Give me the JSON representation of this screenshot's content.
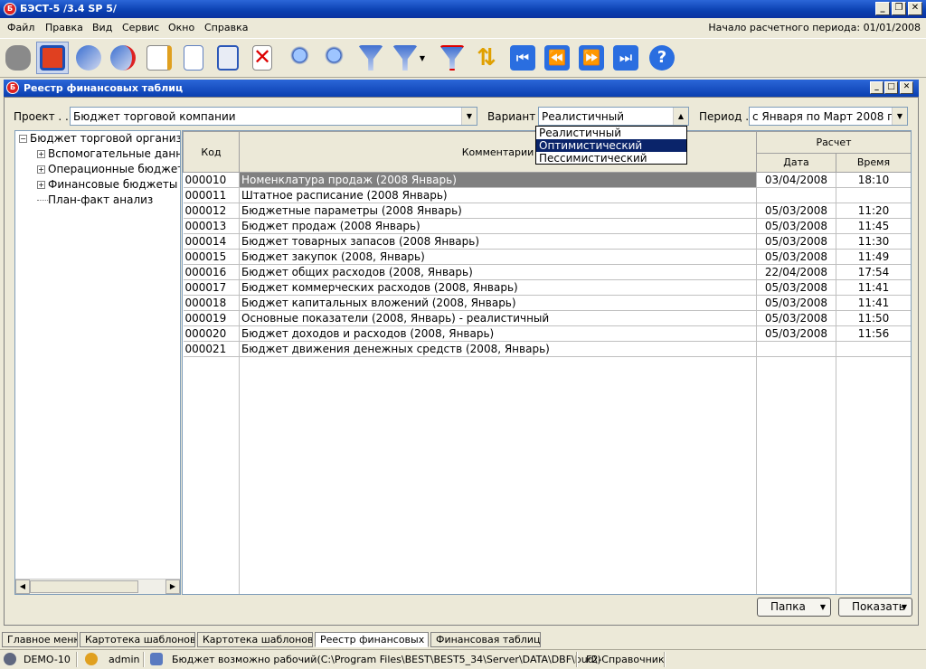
{
  "app": {
    "title": "БЭСТ-5 /3.4 SP 5/",
    "icon_letter": "Б"
  },
  "menu": {
    "items": [
      "Файл",
      "Правка",
      "Вид",
      "Сервис",
      "Окно",
      "Справка"
    ],
    "period_start": "Начало расчетного периода: 01/01/2008"
  },
  "toolbar": {
    "icons": [
      "stone-icon",
      "registry-icon",
      "pills-icon",
      "pills-export-icon",
      "edit-icon",
      "new-document-icon",
      "save-icon",
      "delete-icon",
      "find-icon",
      "find-next-icon",
      "filter-icon",
      "filter-dropdown-icon",
      "clear-filter-icon",
      "refresh-icon",
      "first-record-icon",
      "prev-record-icon",
      "next-record-icon",
      "last-record-icon",
      "help-icon"
    ]
  },
  "child": {
    "title": "Реестр финансовых таблиц"
  },
  "filters": {
    "project_label": "Проект . .",
    "project_value": "Бюджет торговой компании",
    "variant_label": "Вариант .",
    "variant_value": "Реалистичный",
    "period_label": "Период .",
    "period_value": "с Января по Март 2008 г."
  },
  "variant_options": [
    "Реалистичный",
    "Оптимистический",
    "Пессимистический"
  ],
  "tree": {
    "root": "Бюджет торговой организации",
    "children": [
      "Вспомогательные данные",
      "Операционные бюджеты",
      "Финансовые бюджеты",
      "План-факт анализ"
    ]
  },
  "grid": {
    "headers": {
      "code": "Код",
      "comments": "Комментарии",
      "calc": "Расчет",
      "date": "Дата",
      "time": "Время"
    },
    "rows": [
      {
        "code": "000010",
        "comment": "Номенклатура продаж (2008 Январь)",
        "date": "03/04/2008",
        "time": "18:10"
      },
      {
        "code": "000011",
        "comment": "Штатное расписание (2008 Январь)",
        "date": "",
        "time": ""
      },
      {
        "code": "000012",
        "comment": "Бюджетные параметры (2008 Январь)",
        "date": "05/03/2008",
        "time": "11:20"
      },
      {
        "code": "000013",
        "comment": "Бюджет продаж (2008 Январь)",
        "date": "05/03/2008",
        "time": "11:45"
      },
      {
        "code": "000014",
        "comment": "Бюджет товарных запасов (2008 Январь)",
        "date": "05/03/2008",
        "time": "11:30"
      },
      {
        "code": "000015",
        "comment": "Бюджет закупок (2008, Январь)",
        "date": "05/03/2008",
        "time": "11:49"
      },
      {
        "code": "000016",
        "comment": "Бюджет общих расходов (2008, Январь)",
        "date": "22/04/2008",
        "time": "17:54"
      },
      {
        "code": "000017",
        "comment": "Бюджет коммерческих расходов (2008, Январь)",
        "date": "05/03/2008",
        "time": "11:41"
      },
      {
        "code": "000018",
        "comment": "Бюджет капитальных вложений (2008, Январь)",
        "date": "05/03/2008",
        "time": "11:41"
      },
      {
        "code": "000019",
        "comment": "Основные показатели (2008, Январь) - реалистичный",
        "date": "05/03/2008",
        "time": "11:50"
      },
      {
        "code": "000020",
        "comment": "Бюджет доходов и расходов (2008, Январь)",
        "date": "05/03/2008",
        "time": "11:56"
      },
      {
        "code": "000021",
        "comment": "Бюджет движения денежных средств (2008, Январь)",
        "date": "",
        "time": ""
      }
    ]
  },
  "buttons": {
    "folder": "Папка",
    "show": "Показать"
  },
  "tasktabs": [
    "Главное меню",
    "Картотека шаблонов б",
    "Картотека шаблонов б",
    "Реестр финансовых та",
    "Финансовая таблица"
  ],
  "status": {
    "db": "DEMO-10",
    "user": "admin",
    "path": "Бюджет возможно рабочий(C:\\Program Files\\BEST\\BEST5_34\\Server\\DATA\\DBF\\bud\\)",
    "hint": "F2-Справочник"
  }
}
